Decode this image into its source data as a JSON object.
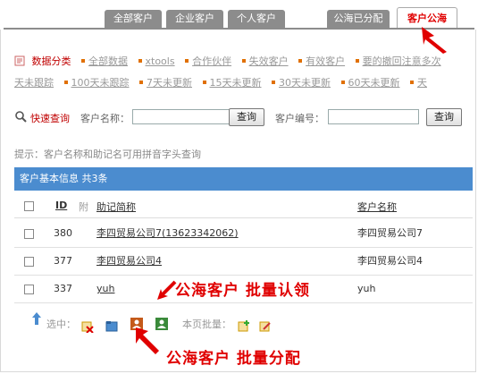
{
  "tabs": [
    {
      "label": "全部客户"
    },
    {
      "label": "企业客户"
    },
    {
      "label": "个人客户"
    },
    {
      "label": "公海已分配"
    },
    {
      "label": "客户公海",
      "active": true
    }
  ],
  "categories": {
    "title": "数据分类",
    "row1": [
      "全部数据",
      "xtools",
      "合作伙伴",
      "失效客户",
      "有效客户",
      "要的撤回注意多次"
    ],
    "row2": [
      "天未跟踪",
      "100天未跟踪",
      "7天未更新",
      "15天未更新",
      "30天未更新",
      "60天未更新",
      "天"
    ]
  },
  "search": {
    "title": "快速查询",
    "name_label": "客户名称：",
    "name_value": "",
    "button": "查询",
    "id_label": "客户编号：",
    "id_value": "",
    "button2": "查询"
  },
  "hint": "提示：客户名称和助记名可用拼音字头查询",
  "table": {
    "header": "客户基本信息  共3条",
    "columns": {
      "id": "ID",
      "attach": "附",
      "short": "助记简称",
      "name": "客户名称"
    },
    "rows": [
      {
        "id": "380",
        "short": "李四贸易公司7(13623342062)",
        "name": "李四贸易公司7"
      },
      {
        "id": "377",
        "short": "李四贸易公司4",
        "name": "李四贸易公司4"
      },
      {
        "id": "337",
        "short": "yuh",
        "name": "yuh"
      }
    ]
  },
  "footer": {
    "selected_label": "选中：",
    "page_batch_label": "本页批量："
  },
  "annotations": {
    "claim": "公海客户 批量认领",
    "assign": "公海客户 批量分配"
  },
  "colors": {
    "accent": "#e00000",
    "header_blue": "#4b8ccf",
    "tab_gray": "#8c8c8c"
  }
}
